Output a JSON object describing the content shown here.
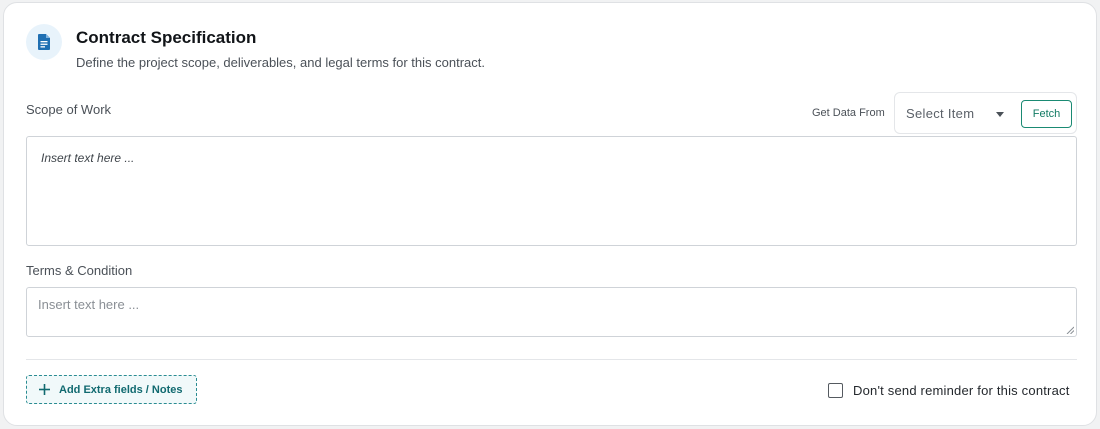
{
  "header": {
    "icon": "document-icon",
    "title": "Contract Specification",
    "subtitle": "Define the project scope, deliverables, and legal terms for this contract."
  },
  "scope": {
    "label": "Scope of Work",
    "get_data_from_label": "Get Data From",
    "select": {
      "value": "Select Item"
    },
    "fetch_label": "Fetch",
    "placeholder": "Insert text here ..."
  },
  "terms": {
    "label": "Terms & Condition",
    "placeholder": "Insert text here ..."
  },
  "footer": {
    "add_fields_label": "Add Extra fields / Notes",
    "reminder_label": "Don't send reminder for this contract",
    "reminder_checked": false
  },
  "colors": {
    "accent_teal": "#117a63",
    "icon_bg": "#e8f3fb",
    "icon_fg": "#1f6fb2"
  }
}
